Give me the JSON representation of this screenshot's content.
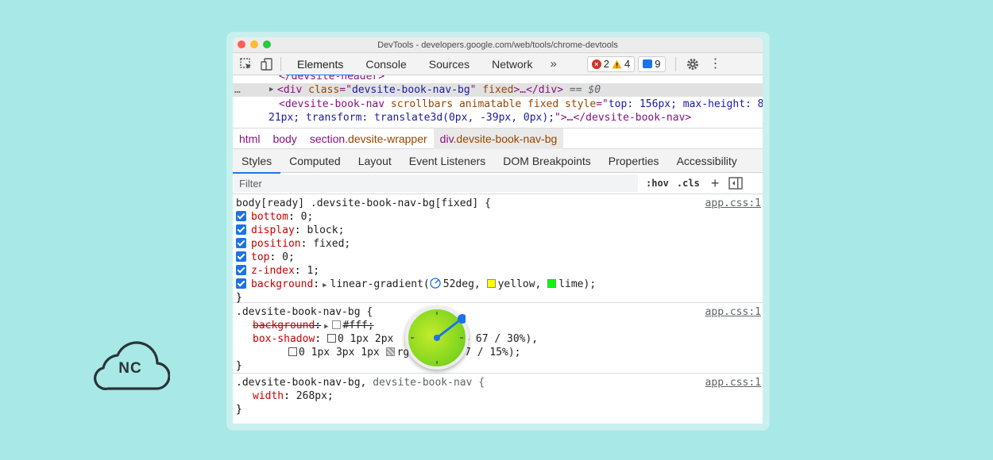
{
  "window": {
    "title": "DevTools - developers.google.com/web/tools/chrome-devtools"
  },
  "toolbar": {
    "tabs": [
      "Elements",
      "Console",
      "Sources",
      "Network"
    ],
    "more": "»",
    "errors": "2",
    "warnings": "4",
    "messages": "9"
  },
  "dom": {
    "line0": "</devsite-header>",
    "line1": {
      "dots": "…",
      "open": "<div ",
      "attr": "class",
      "eq": "=\"",
      "val": "devsite-book-nav-bg",
      "q": "\"",
      "attr2": " fixed",
      "close": ">…</div>",
      "note": " == $0"
    },
    "line2": {
      "open": "<devsite-book-nav ",
      "attrs": "scrollbars animatable fixed ",
      "attr": "style",
      "eq": "=\"",
      "val": "top: 156px; max-height: 8"
    },
    "line3": {
      "val": "21px; transform: translate3d(0px, -39px, 0px);",
      "q": "\"",
      "close": ">…</devsite-book-nav>"
    }
  },
  "breadcrumbs": {
    "html": "html",
    "body": "body",
    "section_tag": "section",
    "section_cls": ".devsite-wrapper",
    "div_tag": "div",
    "div_cls": ".devsite-book-nav-bg"
  },
  "subtabs": [
    "Styles",
    "Computed",
    "Layout",
    "Event Listeners",
    "DOM Breakpoints",
    "Properties",
    "Accessibility"
  ],
  "filter": {
    "placeholder": "Filter",
    "hov": ":hov",
    "cls": ".cls",
    "plus": "+"
  },
  "rules": {
    "r1": {
      "selector": "body[ready] .devsite-book-nav-bg[fixed] {",
      "source": "app.css:1",
      "decls": [
        {
          "prop": "bottom",
          "val": "0;"
        },
        {
          "prop": "display",
          "val": "block;"
        },
        {
          "prop": "position",
          "val": "fixed;"
        },
        {
          "prop": "top",
          "val": "0;"
        },
        {
          "prop": "z-index",
          "val": "1;"
        }
      ],
      "bg_prop": "background",
      "bg_fn": "linear-gradient(",
      "bg_angle": "52deg,",
      "bg_c1": "yellow,",
      "bg_c2": "lime);",
      "close": "}"
    },
    "r2": {
      "selector": ".devsite-book-nav-bg {",
      "source": "app.css:1",
      "bg_prop": "background",
      "bg_val": "#fff;",
      "shadow_prop": "box-shadow",
      "shadow_l1a": "0 1px 2px",
      "shadow_l1b": "54 67 / 30%),",
      "shadow_l2a": "0 1px 3px 1px",
      "shadow_l2b": "rg",
      "shadow_l2c": "67 / 15%);",
      "close": "}"
    },
    "r3": {
      "selector": ".devsite-book-nav-bg,",
      "selector2": "devsite-book-nav {",
      "source": "app.css:1",
      "prop": "width",
      "val": "268px;",
      "close": "}"
    }
  },
  "logo": {
    "text": "NC"
  },
  "colors": {
    "accent": "#1a73e8",
    "background": "#a8e8e6",
    "swatch_yellow": "#ffff00",
    "swatch_lime": "#00ff00",
    "swatch_white": "#ffffff"
  }
}
